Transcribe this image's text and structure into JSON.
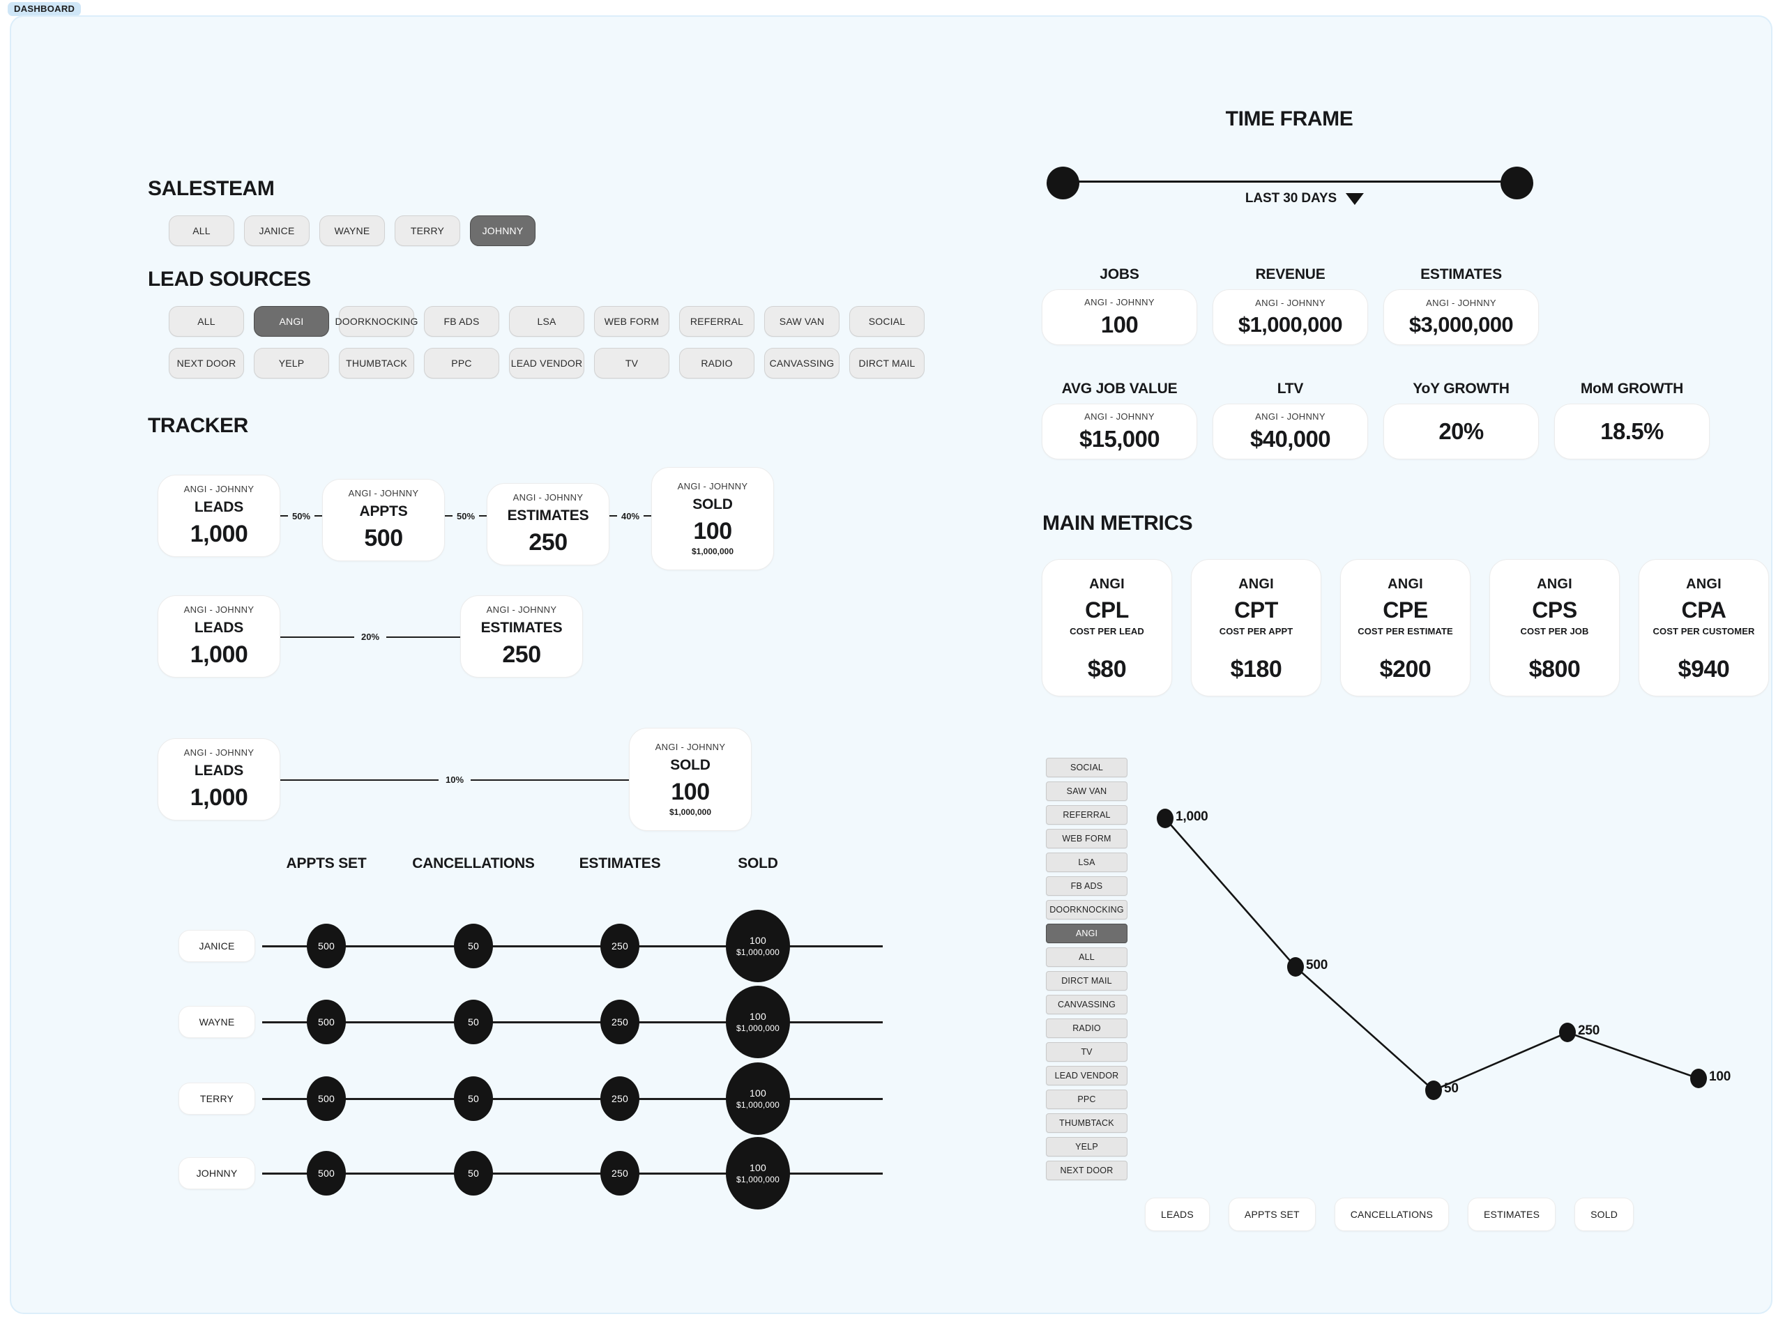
{
  "app": {
    "badge": "DASHBOARD"
  },
  "salesteam": {
    "title": "SALESTEAM",
    "items": [
      {
        "label": "ALL",
        "selected": false
      },
      {
        "label": "JANICE",
        "selected": false
      },
      {
        "label": "WAYNE",
        "selected": false
      },
      {
        "label": "TERRY",
        "selected": false
      },
      {
        "label": "JOHNNY",
        "selected": true
      }
    ]
  },
  "lead_sources": {
    "title": "LEAD SOURCES",
    "row1": [
      {
        "label": "ALL",
        "selected": false
      },
      {
        "label": "ANGI",
        "selected": true
      },
      {
        "label": "DOORKNOCKING",
        "selected": false
      },
      {
        "label": "FB ADS",
        "selected": false
      },
      {
        "label": "LSA",
        "selected": false
      },
      {
        "label": "WEB FORM",
        "selected": false
      },
      {
        "label": "REFERRAL",
        "selected": false
      },
      {
        "label": "SAW VAN",
        "selected": false
      },
      {
        "label": "SOCIAL",
        "selected": false
      }
    ],
    "row2": [
      {
        "label": "NEXT DOOR",
        "selected": false
      },
      {
        "label": "YELP",
        "selected": false
      },
      {
        "label": "THUMBTACK",
        "selected": false
      },
      {
        "label": "PPC",
        "selected": false
      },
      {
        "label": "LEAD VENDOR",
        "selected": false
      },
      {
        "label": "TV",
        "selected": false
      },
      {
        "label": "RADIO",
        "selected": false
      },
      {
        "label": "CANVASSING",
        "selected": false
      },
      {
        "label": "DIRCT MAIL",
        "selected": false
      }
    ]
  },
  "tracker": {
    "title": "TRACKER",
    "row1": {
      "cards": [
        {
          "sub": "ANGI - JOHNNY",
          "name": "LEADS",
          "value": "1,000"
        },
        {
          "sub": "ANGI - JOHNNY",
          "name": "APPTS",
          "value": "500"
        },
        {
          "sub": "ANGI - JOHNNY",
          "name": "ESTIMATES",
          "value": "250"
        },
        {
          "sub": "ANGI - JOHNNY",
          "name": "SOLD",
          "value": "100",
          "money": "$1,000,000"
        }
      ],
      "connectors": [
        "50%",
        "50%",
        "40%"
      ]
    },
    "row2": {
      "cards": [
        {
          "sub": "ANGI - JOHNNY",
          "name": "LEADS",
          "value": "1,000"
        },
        {
          "sub": "ANGI - JOHNNY",
          "name": "ESTIMATES",
          "value": "250"
        }
      ],
      "connector": "20%"
    },
    "row3": {
      "cards": [
        {
          "sub": "ANGI - JOHNNY",
          "name": "LEADS",
          "value": "1,000"
        },
        {
          "sub": "ANGI - JOHNNY",
          "name": "SOLD",
          "value": "100",
          "money": "$1,000,000"
        }
      ],
      "connector": "10%"
    }
  },
  "rep_table": {
    "headers": [
      "APPTS SET",
      "CANCELLATIONS",
      "ESTIMATES",
      "SOLD"
    ],
    "rows": [
      {
        "name": "JANICE",
        "appts": "500",
        "cancellations": "50",
        "estimates": "250",
        "sold": "100",
        "sold_money": "$1,000,000"
      },
      {
        "name": "WAYNE",
        "appts": "500",
        "cancellations": "50",
        "estimates": "250",
        "sold": "100",
        "sold_money": "$1,000,000"
      },
      {
        "name": "TERRY",
        "appts": "500",
        "cancellations": "50",
        "estimates": "250",
        "sold": "100",
        "sold_money": "$1,000,000"
      },
      {
        "name": "JOHNNY",
        "appts": "500",
        "cancellations": "50",
        "estimates": "250",
        "sold": "100",
        "sold_money": "$1,000,000"
      }
    ]
  },
  "time_frame": {
    "title": "TIME FRAME",
    "selected": "LAST 30 DAYS"
  },
  "kpis": [
    {
      "label": "JOBS",
      "sub": "ANGI - JOHNNY",
      "value": "100"
    },
    {
      "label": "REVENUE",
      "sub": "ANGI - JOHNNY",
      "value": "$1,000,000"
    },
    {
      "label": "ESTIMATES",
      "sub": "ANGI - JOHNNY",
      "value": "$3,000,000"
    },
    {
      "label": "AVG JOB VALUE",
      "sub": "ANGI - JOHNNY",
      "value": "$15,000"
    },
    {
      "label": "LTV",
      "sub": "ANGI - JOHNNY",
      "value": "$40,000"
    },
    {
      "label": "YoY GROWTH",
      "sub": "",
      "value": "20%"
    },
    {
      "label": "MoM GROWTH",
      "sub": "",
      "value": "18.5%"
    }
  ],
  "main_metrics": {
    "title": "MAIN METRICS",
    "cards": [
      {
        "brand": "ANGI",
        "code": "CPL",
        "desc": "COST PER LEAD",
        "value": "$80"
      },
      {
        "brand": "ANGI",
        "code": "CPT",
        "desc": "COST PER APPT",
        "value": "$180"
      },
      {
        "brand": "ANGI",
        "code": "CPE",
        "desc": "COST PER ESTIMATE",
        "value": "$200"
      },
      {
        "brand": "ANGI",
        "code": "CPS",
        "desc": "COST PER JOB",
        "value": "$800"
      },
      {
        "brand": "ANGI",
        "code": "CPA",
        "desc": "COST PER CUSTOMER",
        "value": "$940"
      }
    ]
  },
  "chart_legend": [
    {
      "label": "SOCIAL",
      "selected": false
    },
    {
      "label": "SAW VAN",
      "selected": false
    },
    {
      "label": "REFERRAL",
      "selected": false
    },
    {
      "label": "WEB FORM",
      "selected": false
    },
    {
      "label": "LSA",
      "selected": false
    },
    {
      "label": "FB ADS",
      "selected": false
    },
    {
      "label": "DOORKNOCKING",
      "selected": false
    },
    {
      "label": "ANGI",
      "selected": true
    },
    {
      "label": "ALL",
      "selected": false
    },
    {
      "label": "DIRCT MAIL",
      "selected": false
    },
    {
      "label": "CANVASSING",
      "selected": false
    },
    {
      "label": "RADIO",
      "selected": false
    },
    {
      "label": "TV",
      "selected": false
    },
    {
      "label": "LEAD VENDOR",
      "selected": false
    },
    {
      "label": "PPC",
      "selected": false
    },
    {
      "label": "THUMBTACK",
      "selected": false
    },
    {
      "label": "YELP",
      "selected": false
    },
    {
      "label": "NEXT DOOR",
      "selected": false
    }
  ],
  "chart_data": {
    "type": "line",
    "title": "",
    "xlabel": "",
    "ylabel": "",
    "categories": [
      "LEADS",
      "APPTS SET",
      "CANCELLATIONS",
      "ESTIMATES",
      "SOLD"
    ],
    "values": [
      1000,
      500,
      50,
      250,
      100
    ],
    "point_labels": [
      "1,000",
      "500",
      "50",
      "250",
      "100"
    ],
    "ylim": [
      0,
      1000
    ],
    "grid": false,
    "legend_position": "left",
    "series": [
      {
        "name": "ANGI",
        "values": [
          1000,
          500,
          50,
          250,
          100
        ]
      }
    ]
  },
  "chart_axis_buttons": [
    "LEADS",
    "APPTS SET",
    "CANCELLATIONS",
    "ESTIMATES",
    "SOLD"
  ]
}
